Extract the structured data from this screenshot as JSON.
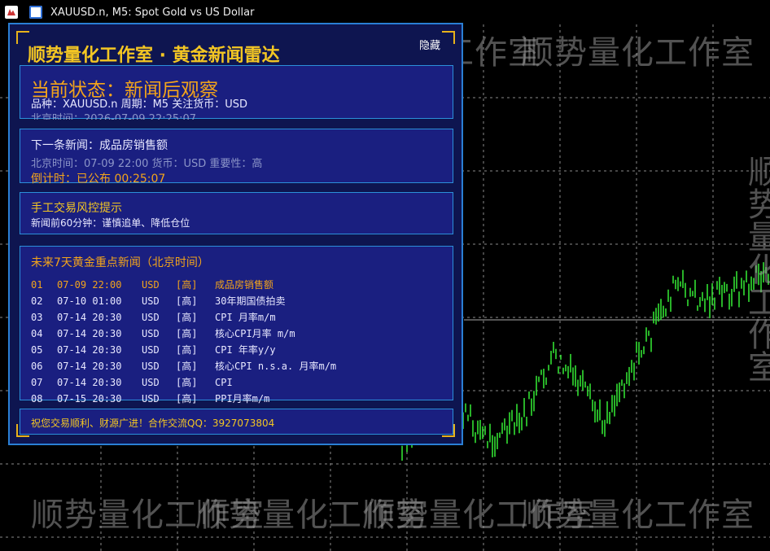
{
  "window": {
    "title": "XAUUSD.n, M5:  Spot Gold vs US Dollar"
  },
  "watermark": {
    "text": "顺势量化工作室"
  },
  "panel": {
    "title": "顺势量化工作室 · 黄金新闻雷达",
    "hide_label": "隐藏",
    "status": {
      "main": "当前状态：新闻后观察",
      "info": "品种：XAUUSD.n   周期：M5   关注货币：USD",
      "time": "北京时间：2026-07-09 22:25:07"
    },
    "next_news": {
      "title": "下一条新闻：成品房销售额",
      "info": "北京时间：07-09 22:00   货币：USD   重要性：高",
      "countdown": "倒计时：已公布 00:25:07"
    },
    "risk": {
      "title": "手工交易风控提示",
      "text": "新闻前60分钟：谨慎追单、降低仓位"
    },
    "upcoming": {
      "title": "未来7天黄金重点新闻（北京时间）",
      "rows": [
        {
          "no": "01",
          "datetime": "07-09 22:00",
          "currency": "USD",
          "importance": "[高]",
          "event": "成品房销售额",
          "highlight": true
        },
        {
          "no": "02",
          "datetime": "07-10 01:00",
          "currency": "USD",
          "importance": "[高]",
          "event": "30年期国债拍卖",
          "highlight": false
        },
        {
          "no": "03",
          "datetime": "07-14 20:30",
          "currency": "USD",
          "importance": "[高]",
          "event": "CPI 月率m/m",
          "highlight": false
        },
        {
          "no": "04",
          "datetime": "07-14 20:30",
          "currency": "USD",
          "importance": "[高]",
          "event": "核心CPI月率 m/m",
          "highlight": false
        },
        {
          "no": "05",
          "datetime": "07-14 20:30",
          "currency": "USD",
          "importance": "[高]",
          "event": "CPI 年率y/y",
          "highlight": false
        },
        {
          "no": "06",
          "datetime": "07-14 20:30",
          "currency": "USD",
          "importance": "[高]",
          "event": "核心CPI n.s.a. 月率m/m",
          "highlight": false
        },
        {
          "no": "07",
          "datetime": "07-14 20:30",
          "currency": "USD",
          "importance": "[高]",
          "event": "CPI",
          "highlight": false
        },
        {
          "no": "08",
          "datetime": "07-15 20:30",
          "currency": "USD",
          "importance": "[高]",
          "event": "PPI月率m/m",
          "highlight": false
        }
      ]
    },
    "footer": "祝您交易顺利、财源广进！合作交流QQ：3927073804"
  },
  "colors": {
    "panel_bg": "#0e1550",
    "box_bg": "#1a1f80",
    "accent_orange": "#f3a41b",
    "accent_yellow": "#f3c623",
    "border_blue": "#2b8fd9",
    "candle": "#32e032"
  },
  "icons": [
    "chart-type-icon",
    "terminal-icon"
  ]
}
